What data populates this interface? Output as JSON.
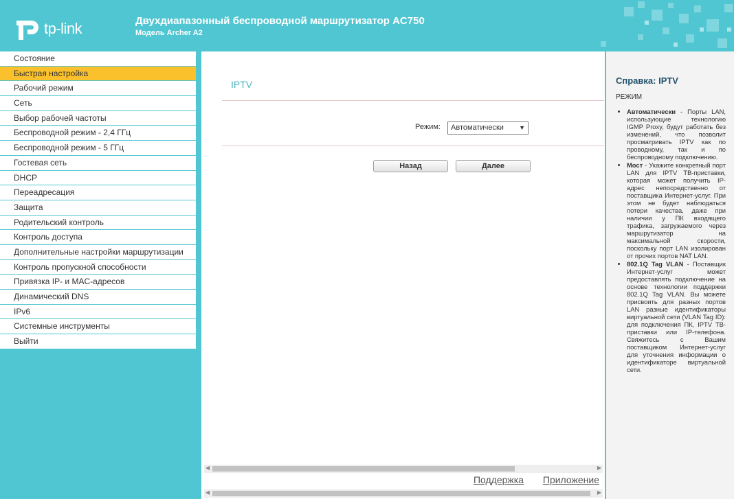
{
  "header": {
    "logo_text": "tp-link",
    "title": "Двухдиапазонный беспроводной маршрутизатор AC750",
    "subtitle": "Модель Archer A2"
  },
  "sidebar": {
    "items": [
      {
        "label": "Состояние"
      },
      {
        "label": "Быстрая настройка",
        "active": true
      },
      {
        "label": "Рабочий режим"
      },
      {
        "label": "Сеть"
      },
      {
        "label": "Выбор рабочей частоты"
      },
      {
        "label": "Беспроводной режим - 2,4 ГГц"
      },
      {
        "label": "Беспроводной режим - 5 ГГц"
      },
      {
        "label": "Гостевая сеть"
      },
      {
        "label": "DHCP"
      },
      {
        "label": "Переадресация"
      },
      {
        "label": "Защита"
      },
      {
        "label": "Родительский контроль"
      },
      {
        "label": "Контроль доступа"
      },
      {
        "label": "Дополнительные настройки маршрутизации"
      },
      {
        "label": "Контроль пропускной способности"
      },
      {
        "label": "Привязка IP- и MAC-адресов"
      },
      {
        "label": "Динамический DNS"
      },
      {
        "label": "IPv6"
      },
      {
        "label": "Системные инструменты"
      },
      {
        "label": "Выйти"
      }
    ]
  },
  "main": {
    "page_title": "IPTV",
    "mode_label": "Режим:",
    "mode_value": "Автоматически",
    "back_label": "Назад",
    "next_label": "Далее",
    "support_link": "Поддержка",
    "app_link": "Приложение"
  },
  "help": {
    "title": "Справка: IPTV",
    "mode_heading": "РЕЖИМ",
    "items": [
      {
        "term": "Автоматически",
        "text": " - Порты LAN, использующие технологию IGMP Proxy, будут работать без изменений, что позволит просматривать IPTV как по проводному, так и по беспроводному подключению."
      },
      {
        "term": "Мост",
        "text": " - Укажите конкретный порт LAN для IPTV ТВ-приставки, которая может получить IP-адрес непосредственно от поставщика Интернет-услуг. При этом не будет наблюдаться потери качества, даже при наличии у ПК входящего трафика, загружаемого через маршрутизатор на максимальной скорости, поскольку порт LAN изолирован от прочих портов NAT LAN."
      },
      {
        "term": "802.1Q Tag VLAN",
        "text": " - Поставщик Интернет-услуг может предоставлять подключение на основе технологии поддержки 802.1Q Tag VLAN. Вы можете присвоить для разных портов LAN разные идентификаторы виртуальной сети (VLAN Tag ID): для подключения ПК, IPTV ТВ-приставки или IP-телефона. Свяжитесь с Вашим поставщиком Интернет-услуг для уточнения информации о идентификаторе виртуальной сети."
      }
    ]
  },
  "colors": {
    "accent": "#4fc6d1",
    "active_menu": "#fbc12d",
    "help_title": "#23526b"
  }
}
